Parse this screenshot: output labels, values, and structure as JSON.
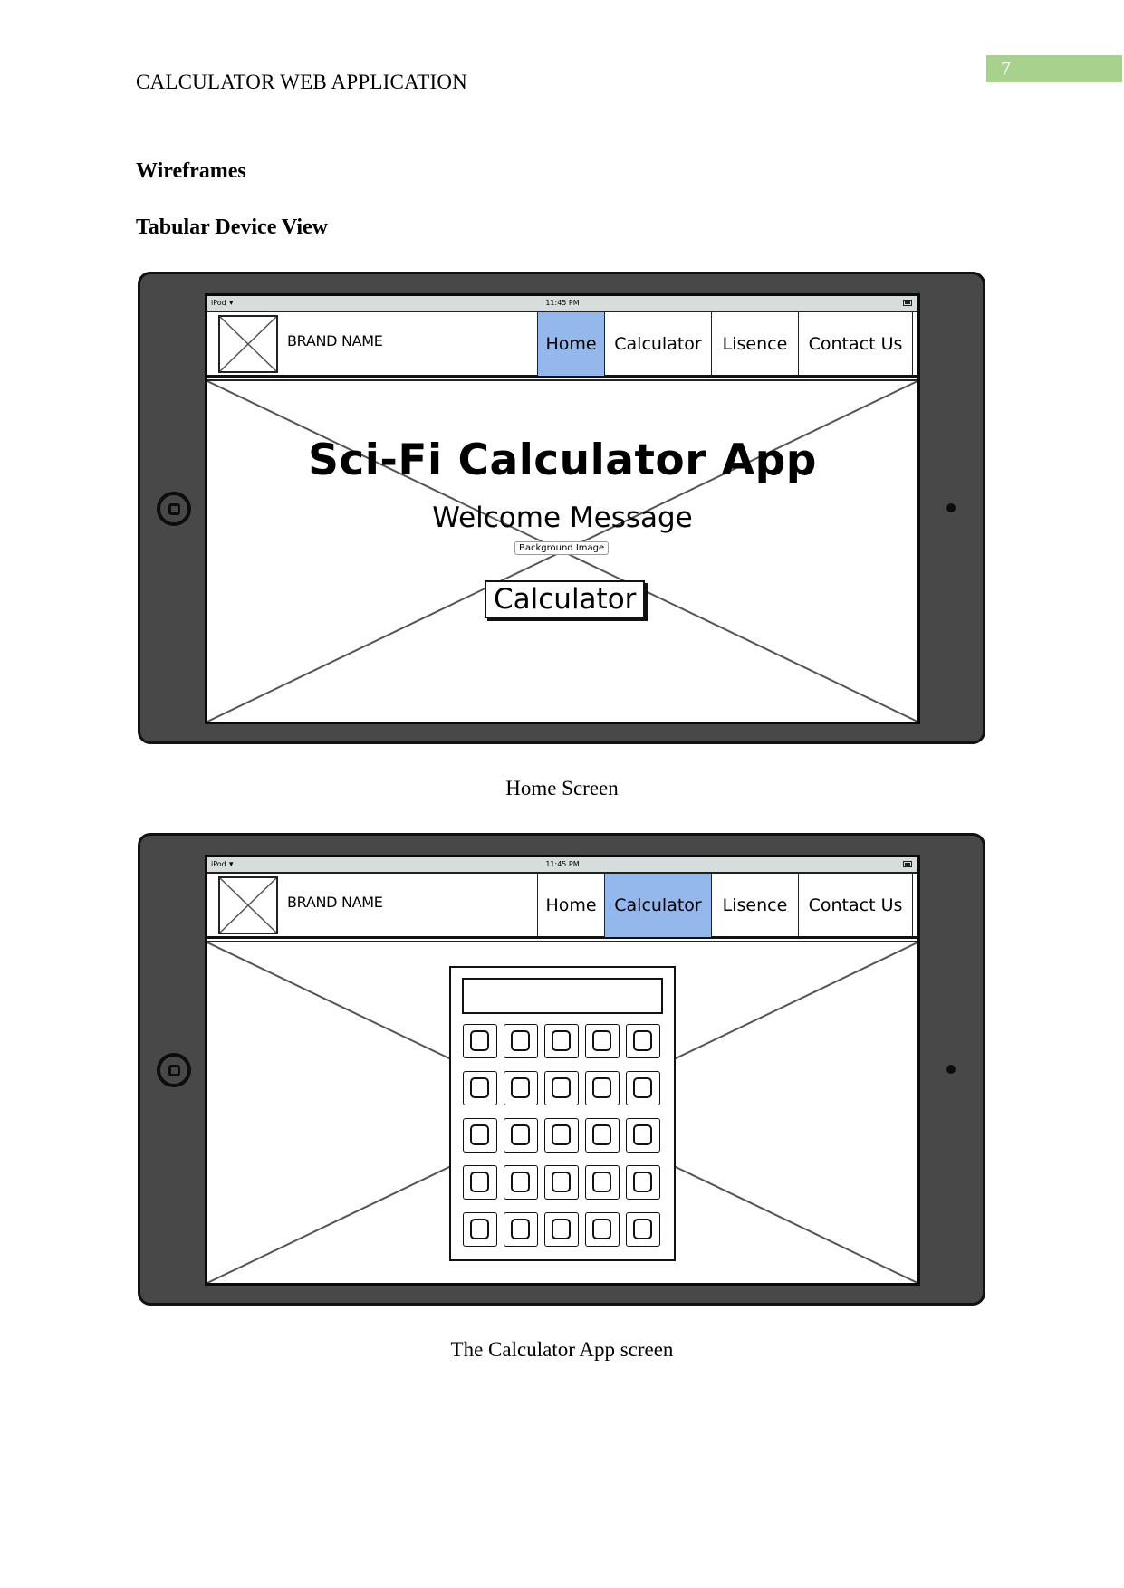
{
  "document": {
    "running_head": "CALCULATOR WEB APPLICATION",
    "page_number": "7",
    "page_number_color": "#a9d18e",
    "heading": "Wireframes",
    "subheading": "Tabular Device View"
  },
  "device_common": {
    "status_bar": {
      "carrier": "iPod",
      "wifi_icon": "wifi-icon",
      "time": "11:45 PM",
      "battery_icon": "battery-icon"
    },
    "brand_name": "BRAND NAME",
    "logo_icon": "image-placeholder-icon",
    "nav_items": [
      "Home",
      "Calculator",
      "Lisence",
      "Contact Us"
    ],
    "active_color": "#95b8ec",
    "bezel_color": "#484848"
  },
  "wireframes": [
    {
      "caption": "Home Screen",
      "active_nav": "Home",
      "background_label": "Background Image",
      "title": "Sci-Fi Calculator App",
      "subtitle": "Welcome Message",
      "button_label": "Calculator"
    },
    {
      "caption": "The Calculator App screen",
      "active_nav": "Calculator",
      "calculator": {
        "display_value": "",
        "rows": 5,
        "columns": 5
      }
    }
  ]
}
